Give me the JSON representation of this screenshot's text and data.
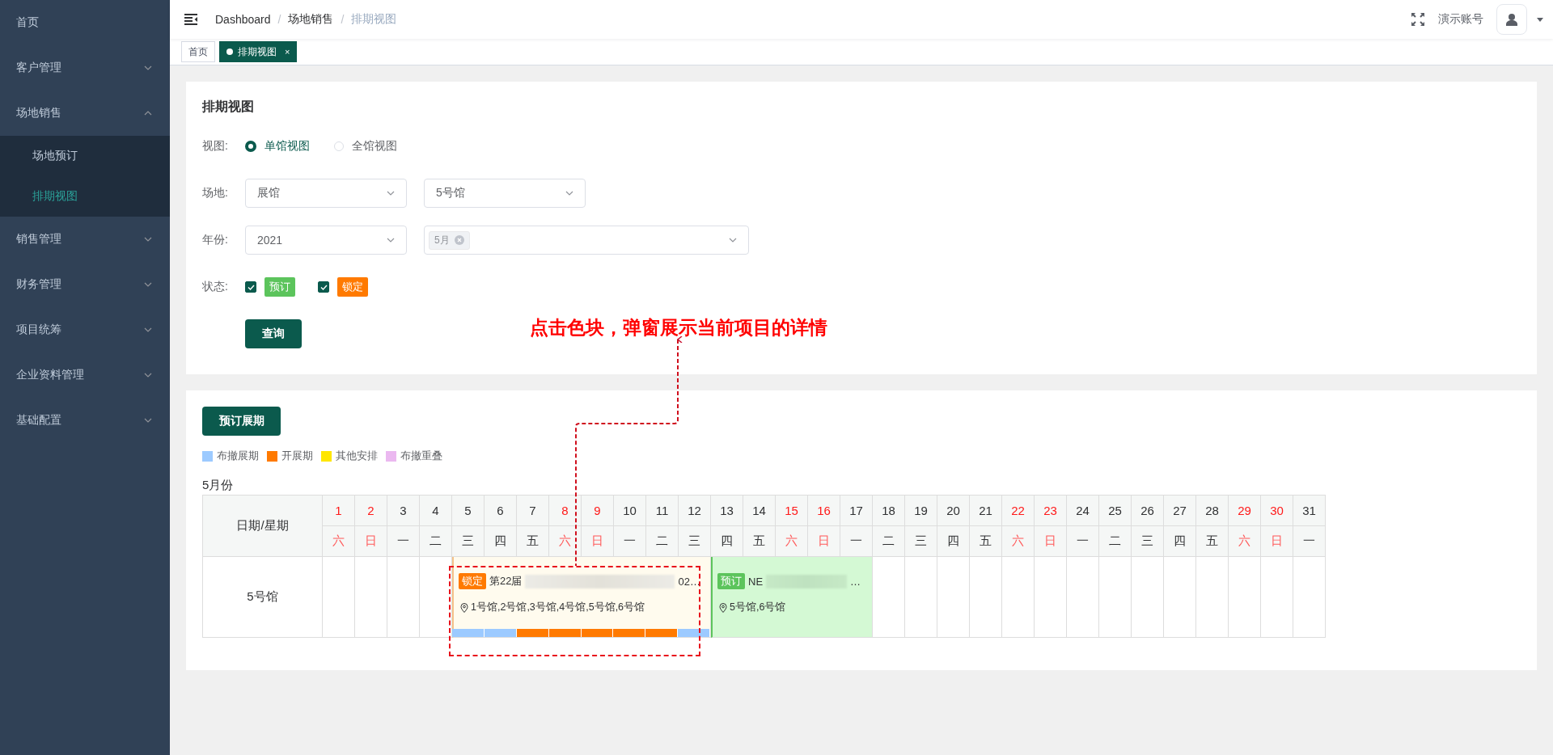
{
  "sidebar": {
    "items": [
      {
        "label": "首页",
        "kind": "link",
        "selected": false
      },
      {
        "label": "客户管理",
        "kind": "group",
        "expanded": false
      },
      {
        "label": "场地销售",
        "kind": "group",
        "expanded": true,
        "children": [
          {
            "label": "场地预订",
            "selected": false
          },
          {
            "label": "排期视图",
            "selected": true
          }
        ]
      },
      {
        "label": "销售管理",
        "kind": "group",
        "expanded": false
      },
      {
        "label": "财务管理",
        "kind": "group",
        "expanded": false
      },
      {
        "label": "项目统筹",
        "kind": "group",
        "expanded": false
      },
      {
        "label": "企业资料管理",
        "kind": "group",
        "expanded": false
      },
      {
        "label": "基础配置",
        "kind": "group",
        "expanded": false
      }
    ]
  },
  "header": {
    "breadcrumb": [
      {
        "kind": "link",
        "label": "Dashboard"
      },
      {
        "kind": "separator",
        "label": "/"
      },
      {
        "kind": "link",
        "label": "场地销售"
      },
      {
        "kind": "separator",
        "label": "/"
      },
      {
        "kind": "current",
        "label": "排期视图"
      }
    ],
    "user": "演示账号"
  },
  "tabs": [
    {
      "label": "首页",
      "selected": false
    },
    {
      "label": "排期视图",
      "selected": true,
      "close": "×"
    }
  ],
  "filter": {
    "title": "排期视图",
    "view": {
      "label": "视图:",
      "options": [
        {
          "label": "单馆视图",
          "selected": true
        },
        {
          "label": "全馆视图",
          "selected": false
        }
      ]
    },
    "venue": {
      "label": "场地:",
      "selects": [
        "展馆",
        "5号馆"
      ]
    },
    "year": {
      "label": "年份:",
      "value": "2021",
      "months": [
        "5月"
      ]
    },
    "status": {
      "label": "状态:",
      "options": [
        {
          "label": "预订",
          "checked": true,
          "color": "#5cc45c"
        },
        {
          "label": "锁定",
          "checked": true,
          "color": "#ff7a00"
        }
      ]
    },
    "submit": "查询"
  },
  "calendar": {
    "book_button": "预订展期",
    "legend": [
      {
        "label": "布撤展期",
        "color": "#9ccaff"
      },
      {
        "label": "开展期",
        "color": "#ff7a00"
      },
      {
        "label": "其他安排",
        "color": "#ffe600"
      },
      {
        "label": "布撤重叠",
        "color": "#ebb8f0"
      }
    ],
    "month": "5月份",
    "corner": "日期/星期",
    "days": [
      {
        "date": "1",
        "weekday": "六",
        "weekend": true
      },
      {
        "date": "2",
        "weekday": "日",
        "weekend": true
      },
      {
        "date": "3",
        "weekday": "一",
        "weekend": false
      },
      {
        "date": "4",
        "weekday": "二",
        "weekend": false
      },
      {
        "date": "5",
        "weekday": "三",
        "weekend": false
      },
      {
        "date": "6",
        "weekday": "四",
        "weekend": false
      },
      {
        "date": "7",
        "weekday": "五",
        "weekend": false
      },
      {
        "date": "8",
        "weekday": "六",
        "weekend": true
      },
      {
        "date": "9",
        "weekday": "日",
        "weekend": true
      },
      {
        "date": "10",
        "weekday": "一",
        "weekend": false
      },
      {
        "date": "11",
        "weekday": "二",
        "weekend": false
      },
      {
        "date": "12",
        "weekday": "三",
        "weekend": false
      },
      {
        "date": "13",
        "weekday": "四",
        "weekend": false
      },
      {
        "date": "14",
        "weekday": "五",
        "weekend": false
      },
      {
        "date": "15",
        "weekday": "六",
        "weekend": true
      },
      {
        "date": "16",
        "weekday": "日",
        "weekend": true
      },
      {
        "date": "17",
        "weekday": "一",
        "weekend": false
      },
      {
        "date": "18",
        "weekday": "二",
        "weekend": false
      },
      {
        "date": "19",
        "weekday": "三",
        "weekend": false
      },
      {
        "date": "20",
        "weekday": "四",
        "weekend": false
      },
      {
        "date": "21",
        "weekday": "五",
        "weekend": false
      },
      {
        "date": "22",
        "weekday": "六",
        "weekend": true
      },
      {
        "date": "23",
        "weekday": "日",
        "weekend": true
      },
      {
        "date": "24",
        "weekday": "一",
        "weekend": false
      },
      {
        "date": "25",
        "weekday": "二",
        "weekend": false
      },
      {
        "date": "26",
        "weekday": "三",
        "weekend": false
      },
      {
        "date": "27",
        "weekday": "四",
        "weekend": false
      },
      {
        "date": "28",
        "weekday": "五",
        "weekend": false
      },
      {
        "date": "29",
        "weekday": "六",
        "weekend": true
      },
      {
        "date": "30",
        "weekday": "日",
        "weekend": true
      },
      {
        "date": "31",
        "weekday": "一",
        "weekend": false
      }
    ],
    "rows": [
      {
        "venue": "5号馆",
        "cells": [
          {
            "kind": "empty"
          },
          {
            "kind": "empty"
          },
          {
            "kind": "empty"
          },
          {
            "kind": "empty"
          },
          {
            "kind": "locked-event",
            "status": "锁定",
            "title_start": "第22届",
            "title_end": "02…",
            "location": "1号馆,2号馆,3号馆,4号馆,5号馆,6号馆",
            "color": "#9ccaff"
          },
          {
            "kind": "locked-event",
            "color": "#9ccaff"
          },
          {
            "kind": "locked-event",
            "color": "#ff7a00"
          },
          {
            "kind": "locked-event",
            "color": "#ff7a00"
          },
          {
            "kind": "locked-event",
            "color": "#ff7a00"
          },
          {
            "kind": "locked-event",
            "color": "#ff7a00"
          },
          {
            "kind": "locked-event",
            "color": "#ff7a00"
          },
          {
            "kind": "locked-event",
            "color": "#9ccaff"
          },
          {
            "kind": "booked-event",
            "status": "预订",
            "title_start": "NE",
            "title_end": "…",
            "location": "5号馆,6号馆"
          },
          {
            "kind": "booked-event"
          },
          {
            "kind": "booked-event"
          },
          {
            "kind": "booked-event"
          },
          {
            "kind": "booked-event"
          },
          {
            "kind": "empty"
          },
          {
            "kind": "empty"
          },
          {
            "kind": "empty"
          },
          {
            "kind": "empty"
          },
          {
            "kind": "empty"
          },
          {
            "kind": "empty"
          },
          {
            "kind": "empty"
          },
          {
            "kind": "empty"
          },
          {
            "kind": "empty"
          },
          {
            "kind": "empty"
          },
          {
            "kind": "empty"
          },
          {
            "kind": "empty"
          },
          {
            "kind": "empty"
          },
          {
            "kind": "empty"
          }
        ]
      }
    ]
  },
  "annotation": {
    "text": "点击色块，弹窗展示当前项目的详情"
  }
}
